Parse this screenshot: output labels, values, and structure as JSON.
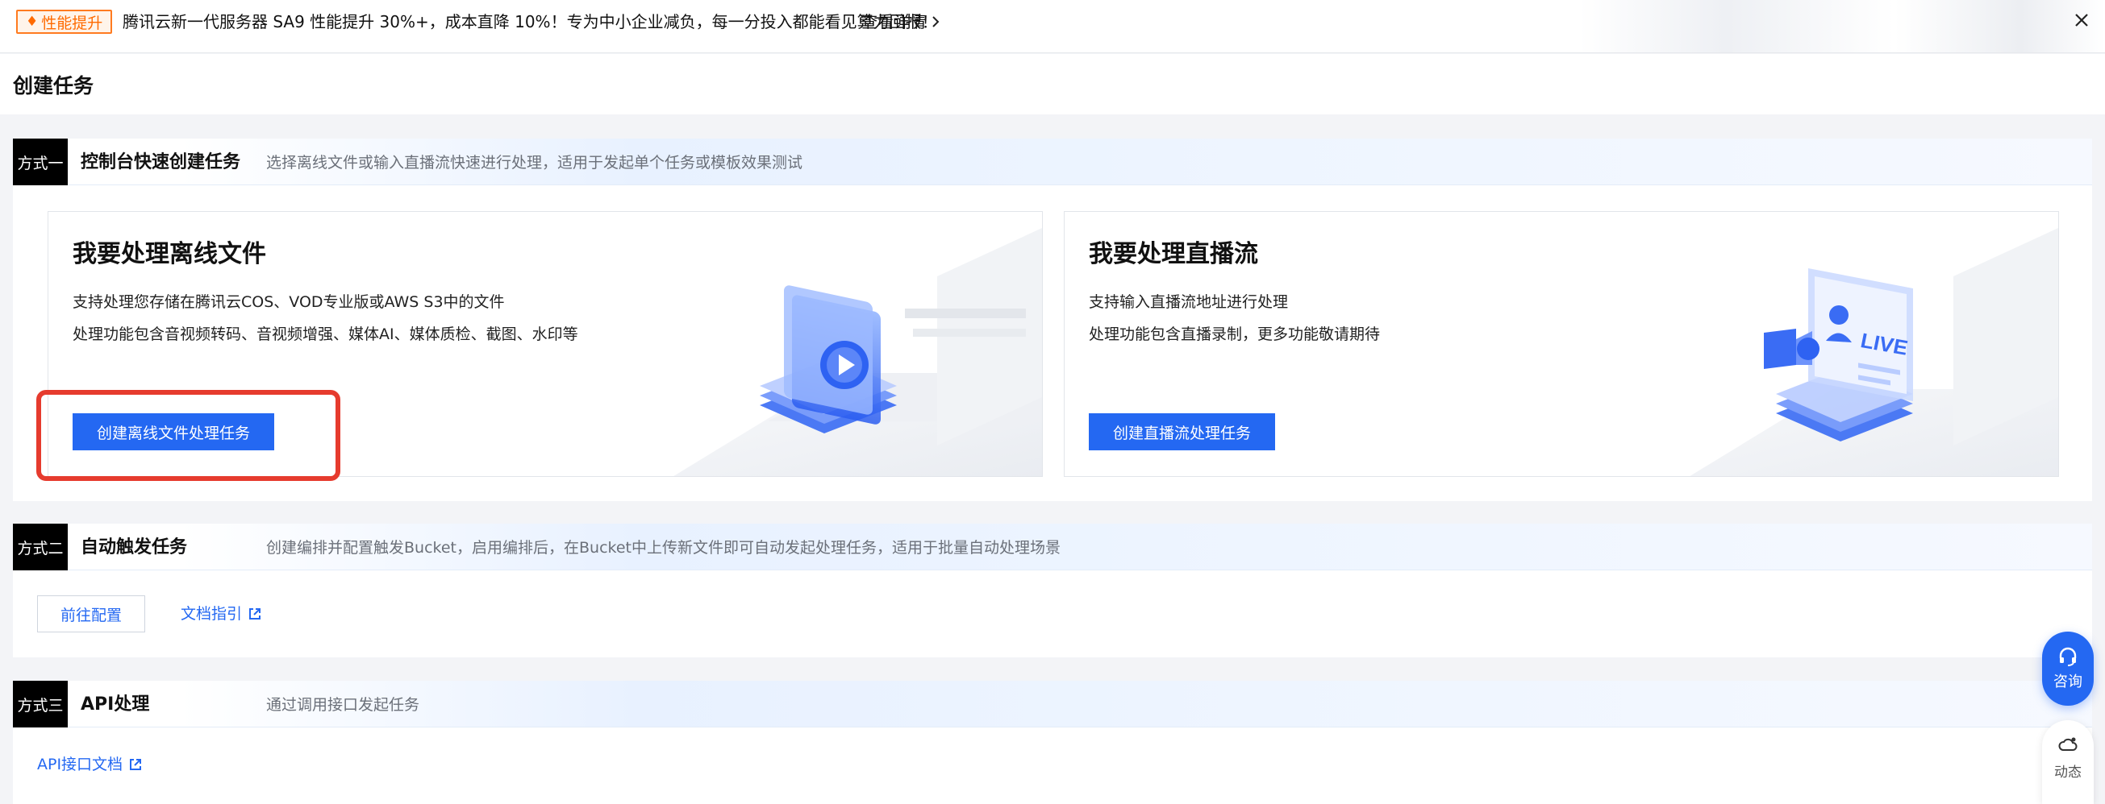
{
  "banner": {
    "tag": "性能提升",
    "text": "腾讯云新一代服务器 SA9 性能提升 30%+，成本直降 10%！专为中小企业减负，每一分投入都能看见算力回报！",
    "link": "查看详情",
    "icons": {
      "tag": "flame-icon",
      "link": "chevron-right-icon",
      "close": "close-icon"
    }
  },
  "page": {
    "title": "创建任务"
  },
  "section1": {
    "badge": "方式一",
    "title": "控制台快速创建任务",
    "desc": "选择离线文件或输入直播流快速进行处理，适用于发起单个任务或模板效果测试",
    "offline": {
      "title": "我要处理离线文件",
      "line1": "支持处理您存储在腾讯云COS、VOD专业版或AWS S3中的文件",
      "line2": "处理功能包含音视频转码、音视频增强、媒体AI、媒体质检、截图、水印等",
      "button": "创建离线文件处理任务"
    },
    "live": {
      "title": "我要处理直播流",
      "line1": "支持输入直播流地址进行处理",
      "line2": "处理功能包含直播录制，更多功能敬请期待",
      "button": "创建直播流处理任务",
      "illus_label": "LIVE"
    }
  },
  "section2": {
    "badge": "方式二",
    "title": "自动触发任务",
    "desc": "创建编排并配置触发Bucket，启用编排后，在Bucket中上传新文件即可自动发起处理任务，适用于批量自动处理场景",
    "config_button": "前往配置",
    "doc_link": "文档指引"
  },
  "section3": {
    "badge": "方式三",
    "title": "API处理",
    "desc": "通过调用接口发起任务",
    "api_link": "API接口文档"
  },
  "widgets": {
    "consult": "咨询",
    "dynamic": "动态"
  },
  "colors": {
    "primary": "#2468f2",
    "highlight": "#e63b2e",
    "tag": "#ff6a00"
  }
}
